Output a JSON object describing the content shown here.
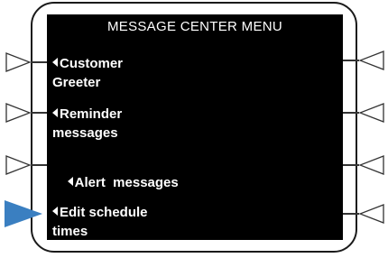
{
  "title": "MESSAGE CENTER MENU",
  "menu_items": [
    {
      "line1": "Customer",
      "line2": "Greeter"
    },
    {
      "line1": "Reminder",
      "line2": "messages"
    },
    {
      "line1": "Alert  messages",
      "line2": ""
    },
    {
      "line1": "Edit schedule",
      "line2": "times"
    }
  ],
  "selected_index": 3,
  "colors": {
    "screen": "#000000",
    "text": "#ffffff",
    "selected_key": "#3a7fc1",
    "key_outline": "#333333"
  },
  "icons": {
    "softkey_left": "triangle-right-icon",
    "softkey_right": "triangle-left-icon",
    "item_marker": "caret-left-icon"
  }
}
